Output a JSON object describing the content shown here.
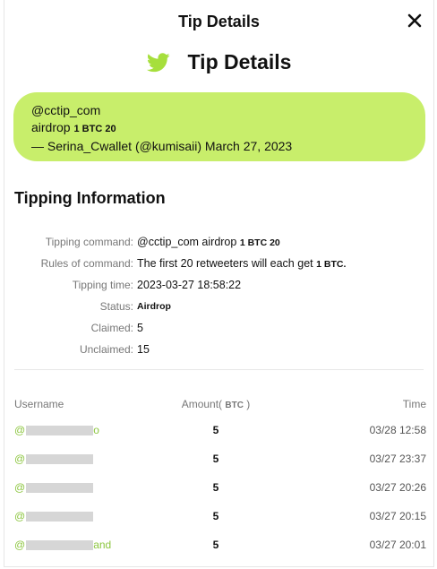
{
  "modal": {
    "title": "Tip Details"
  },
  "headline": {
    "text": "Tip Details"
  },
  "tweet": {
    "line1": "@cctip_com",
    "line2_prefix": "airdrop",
    "line2_amount": "1 BTC 20",
    "line3": "— Serina_Cwallet (@kumisaii) March 27, 2023"
  },
  "tipping_info": {
    "title": "Tipping Information",
    "rows": [
      {
        "label": "Tipping command:",
        "value": "@cctip_com airdrop",
        "value_bold": "1 BTC 20"
      },
      {
        "label": "Rules of command:",
        "value": "The first 20 retweeters will each get",
        "value_bold": "1 BTC."
      },
      {
        "label": "Tipping time:",
        "value": "2023-03-27 18:58:22",
        "value_bold": ""
      },
      {
        "label": "Status:",
        "value": "",
        "value_bold": "Airdrop"
      },
      {
        "label": "Claimed:",
        "value": "5",
        "value_bold": ""
      },
      {
        "label": "Unclaimed:",
        "value": "15",
        "value_bold": ""
      }
    ]
  },
  "table": {
    "headers": {
      "username": "Username",
      "amount": "Amount(",
      "amount_unit": "BTC",
      "amount_close": ")",
      "time": "Time"
    },
    "rows": [
      {
        "user_prefix": "@",
        "user_suffix": "o",
        "amount": "5",
        "time": "03/28 12:58"
      },
      {
        "user_prefix": "@",
        "user_suffix": "",
        "amount": "5",
        "time": "03/27 23:37"
      },
      {
        "user_prefix": "@",
        "user_suffix": "",
        "amount": "5",
        "time": "03/27 20:26"
      },
      {
        "user_prefix": "@",
        "user_suffix": "",
        "amount": "5",
        "time": "03/27 20:15"
      },
      {
        "user_prefix": "@",
        "user_suffix": "and",
        "amount": "5",
        "time": "03/27 20:01"
      }
    ]
  },
  "colors": {
    "accent_green": "#c8ee6b",
    "username_green": "#8cc63f",
    "twitter_bird": "#a6df3c"
  },
  "icons": {
    "close": "close-icon",
    "bird": "twitter-bird-icon"
  }
}
